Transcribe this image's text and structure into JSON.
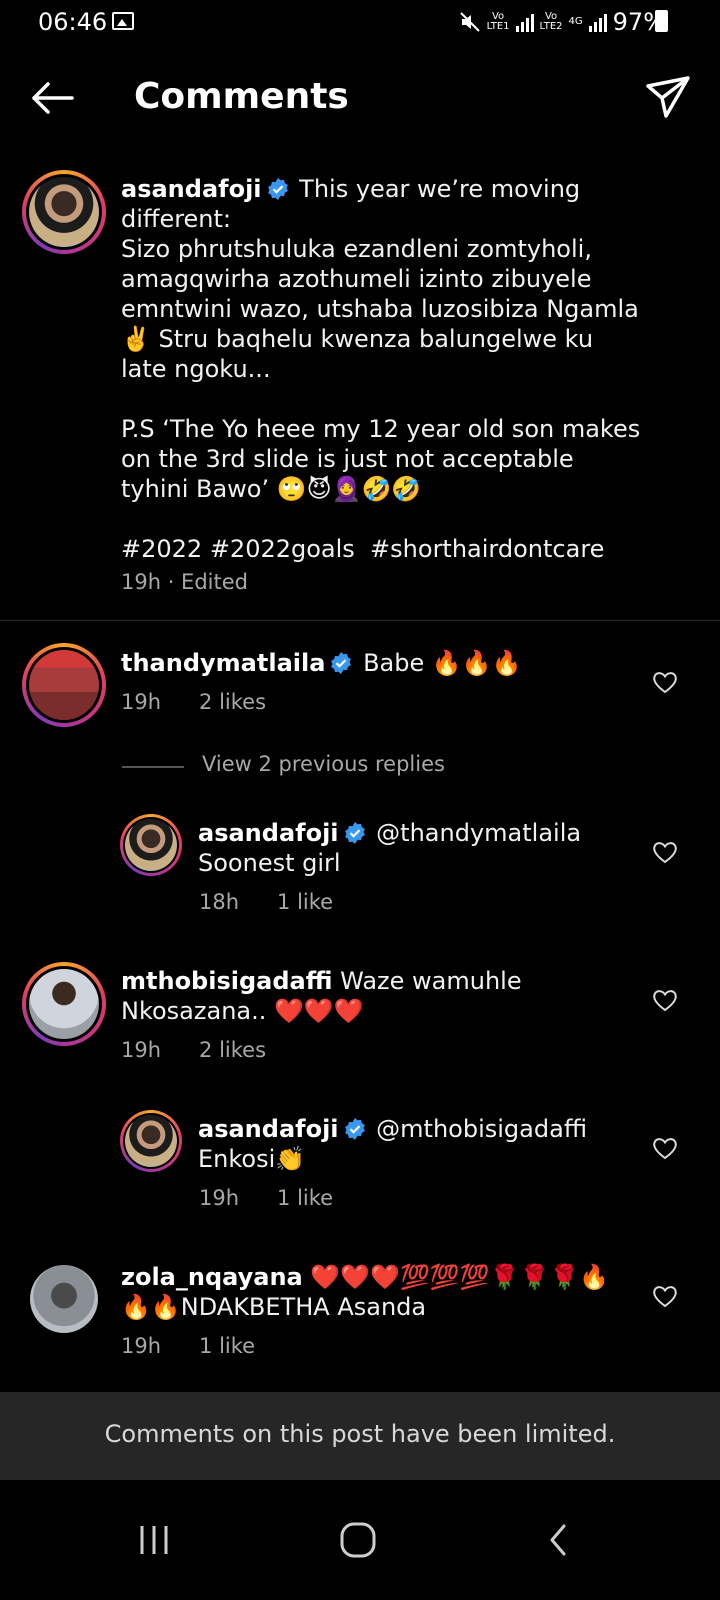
{
  "status_bar": {
    "time": "06:46",
    "sim1_label": "Vo\nLTE1",
    "sim2_label": "Vo\nLTE2",
    "network": "4G",
    "battery": "97%"
  },
  "header": {
    "title": "Comments"
  },
  "caption": {
    "username": "asandafoji",
    "text": "This year we’re moving different:\nSizo phrutshuluka ezandleni zomtyholi, amagqwirha azothumeli izinto zibuyele emntwini wazo, utshaba luzosibiza Ngamla ✌️ Stru baqhelu kwenza balungelwe ku late ngoku...\n\nP.S ‘The Yo heee my 12 year old son makes on the 3rd slide is just not acceptable tyhini Bawo’ 🙄😈🧕🤣🤣\n\n#2022 #2022goals  #shorthairdontcare",
    "time": "19h · Edited"
  },
  "comments": [
    {
      "username": "thandymatlaila",
      "text": "Babe 🔥🔥🔥",
      "time": "19h",
      "likes": "2 likes"
    },
    {
      "username": "mthobisigadaffi",
      "text": "Waze wamuhle Nkosazana.. ❤️❤️❤️",
      "time": "19h",
      "likes": "2 likes"
    },
    {
      "username": "zola_nqayana",
      "text": "❤️❤️❤️💯💯💯🌹🌹🌹🔥🔥🔥NDAKBETHA Asanda",
      "time": "19h",
      "likes": "1 like"
    }
  ],
  "replies": [
    {
      "username": "asandafoji",
      "text": "@thandymatlaila Soonest girl",
      "time": "18h",
      "likes": "1 like"
    },
    {
      "username": "asandafoji",
      "text": "@mthobisigadaffi Enkosi👏",
      "time": "19h",
      "likes": "1 like"
    }
  ],
  "view_replies": "View 2 previous replies",
  "footer": {
    "limited_notice": "Comments on this post have been limited."
  },
  "colors": {
    "background": "#000000",
    "verified": "#3897f0",
    "secondary_text": "#a8a8a8",
    "banner": "#262626"
  }
}
